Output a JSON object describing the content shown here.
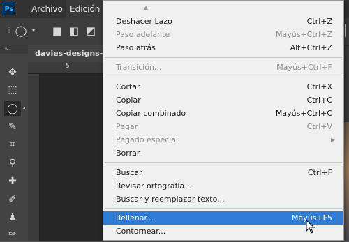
{
  "app": {
    "logo_text": "Ps"
  },
  "menubar": {
    "items": [
      "Archivo",
      "Edición"
    ],
    "active_index": 1
  },
  "document": {
    "tab_title": "davies-designs-stu"
  },
  "ruler": {
    "tick_label": "5"
  },
  "colors": {
    "highlight": "#2e7cd6",
    "menu_bg": "#f0f0f0",
    "app_bg": "#535353"
  },
  "edit_menu": {
    "scroll_indicator": "▲",
    "items": [
      {
        "label": "Deshacer Lazo",
        "shortcut": "Ctrl+Z",
        "enabled": true
      },
      {
        "label": "Paso adelante",
        "shortcut": "Mayús+Ctrl+Z",
        "enabled": false
      },
      {
        "label": "Paso atrás",
        "shortcut": "Alt+Ctrl+Z",
        "enabled": true
      },
      {
        "label": "Transición...",
        "shortcut": "Mayús+Ctrl+F",
        "enabled": false
      },
      {
        "label": "Cortar",
        "shortcut": "Ctrl+X",
        "enabled": true
      },
      {
        "label": "Copiar",
        "shortcut": "Ctrl+C",
        "enabled": true
      },
      {
        "label": "Copiar combinado",
        "shortcut": "Mayús+Ctrl+C",
        "enabled": true
      },
      {
        "label": "Pegar",
        "shortcut": "Ctrl+V",
        "enabled": false
      },
      {
        "label": "Pegado especial",
        "shortcut": "",
        "enabled": false,
        "submenu": true
      },
      {
        "label": "Borrar",
        "shortcut": "",
        "enabled": true
      },
      {
        "label": "Buscar",
        "shortcut": "Ctrl+F",
        "enabled": true
      },
      {
        "label": "Revisar ortografía...",
        "shortcut": "",
        "enabled": true
      },
      {
        "label": "Buscar y reemplazar texto...",
        "shortcut": "",
        "enabled": true
      },
      {
        "label": "Rellenar...",
        "shortcut": "Mayús+F5",
        "enabled": true,
        "highlighted": true
      },
      {
        "label": "Contornear...",
        "shortcut": "",
        "enabled": true
      }
    ]
  }
}
